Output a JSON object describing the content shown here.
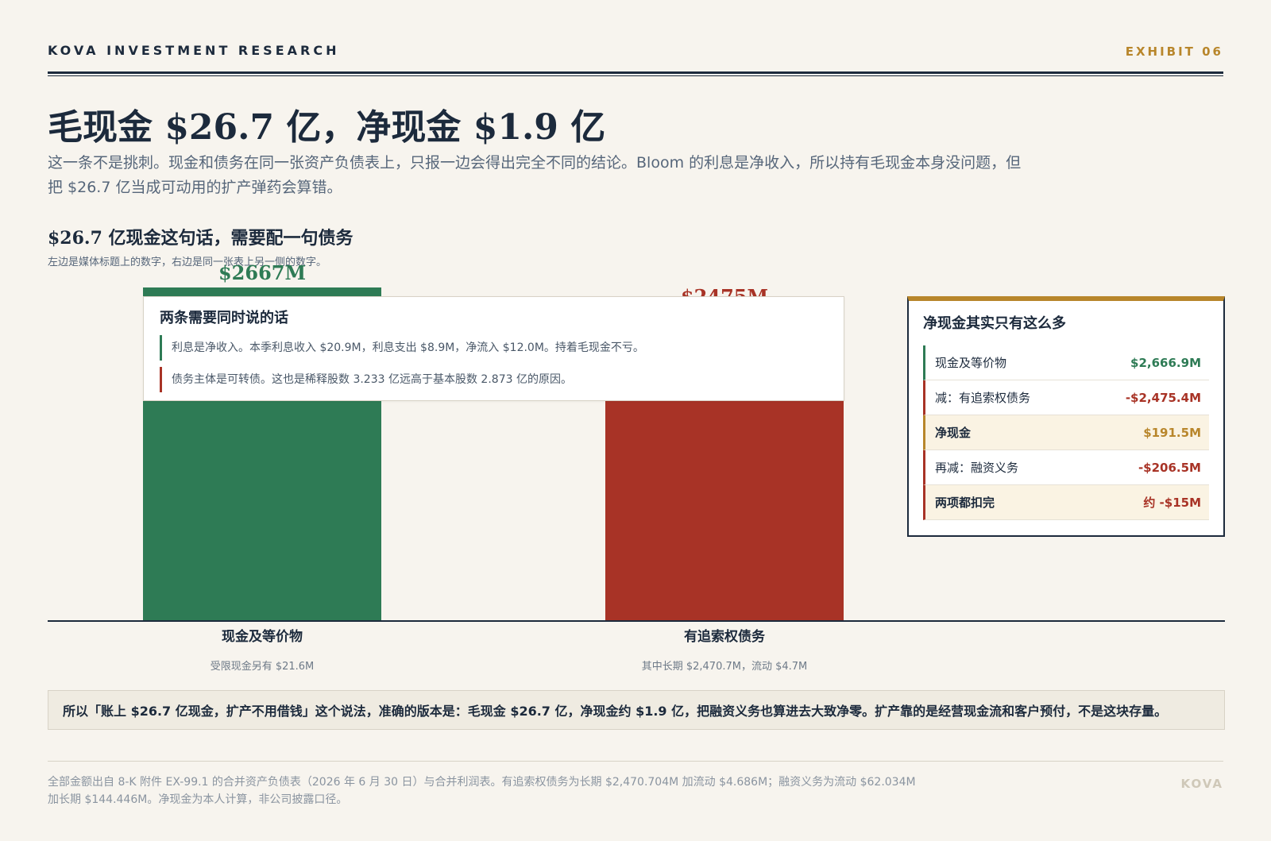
{
  "header": {
    "brand": "KOVA INVESTMENT RESEARCH",
    "exhibit": "EXHIBIT 06"
  },
  "headline": {
    "title": "毛现金 $26.7 亿，净现金 $1.9 亿",
    "lede": "这一条不是挑刺。现金和债务在同一张资产负债表上，只报一边会得出完全不同的结论。Bloom 的利息是净收入，所以持有毛现金本身没问题，但把 $26.7 亿当成可动用的扩产弹药会算错。"
  },
  "chart_data": {
    "type": "bar",
    "title": "$26.7 亿现金这句话，需要配一句债务",
    "subtitle": "左边是媒体标题上的数字，右边是同一张表上另一侧的数字。",
    "categories": [
      "现金及等价物",
      "有追索权债务"
    ],
    "values": [
      2667,
      2475
    ],
    "value_labels": [
      "$2667M",
      "$2475M"
    ],
    "category_notes": [
      "受限现金另有 $21.6M",
      "其中长期 $2,470.7M，流动 $4.7M"
    ],
    "colors": [
      "#2e7b55",
      "#a83326"
    ],
    "ylim": [
      0,
      2667
    ],
    "grid": false
  },
  "callout": {
    "title": "两条需要同时说的话",
    "items": [
      "利息是净收入。本季利息收入 $20.9M，利息支出 $8.9M，净流入 $12.0M。持着毛现金不亏。",
      "债务主体是可转债。这也是稀释股数 3.233 亿远高于基本股数 2.873 亿的原因。"
    ]
  },
  "panel": {
    "title": "净现金其实只有这么多",
    "rows": [
      {
        "label": "现金及等价物",
        "value": "$2,666.9M"
      },
      {
        "label": "减：有追索权债务",
        "value": "-$2,475.4M"
      },
      {
        "label": "净现金",
        "value": "$191.5M"
      },
      {
        "label": "再减：融资义务",
        "value": "-$206.5M"
      },
      {
        "label": "两项都扣完",
        "value": "约 -$15M"
      }
    ]
  },
  "conclusion": "所以「账上 $26.7 亿现金，扩产不用借钱」这个说法，准确的版本是：毛现金 $26.7 亿，净现金约 $1.9 亿，把融资义务也算进去大致净零。扩产靠的是经营现金流和客户预付，不是这块存量。",
  "footer": {
    "note": "全部金额出自 8-K 附件 EX-99.1 的合并资产负债表（2026 年 6 月 30 日）与合并利润表。有追索权债务为长期 $2,470.704M 加流动 $4.686M；融资义务为流动 $62.034M 加长期 $144.446M。净现金为本人计算，非公司披露口径。",
    "brand": "KOVA"
  },
  "colors": {
    "green": "#2e7b55",
    "red": "#a83326",
    "gold": "#b8862b",
    "navy": "#1c2a3c"
  }
}
